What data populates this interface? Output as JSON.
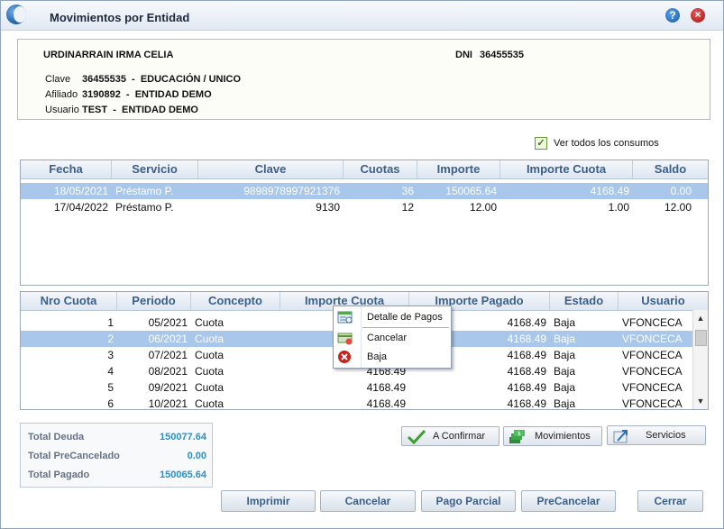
{
  "window": {
    "title": "Movimientos por Entidad"
  },
  "person": {
    "name": "URDINARRAIN IRMA CELIA",
    "dni_label": "DNI",
    "dni": "36455535",
    "clave_label": "Clave",
    "clave": "36455535  -  EDUCACIÓN / UNICO",
    "afiliado_label": "Afiliado",
    "afiliado": "3190892  -  ENTIDAD DEMO",
    "usuario_label": "Usuario",
    "usuario": "TEST  -  ENTIDAD DEMO"
  },
  "ver_todos": {
    "label": "Ver todos los consumos",
    "checked": true
  },
  "consumos": {
    "columns": [
      "Fecha",
      "Servicio",
      "Clave",
      "Cuotas",
      "Importe",
      "Importe Cuota",
      "Saldo"
    ],
    "rows": [
      [
        "18/05/2021",
        "Préstamo P.",
        "9898978997921376",
        "36",
        "150065.64",
        "4168.49",
        "0.00"
      ],
      [
        "17/04/2022",
        "Préstamo P.",
        "9130",
        "12",
        "12.00",
        "1.00",
        "12.00"
      ]
    ]
  },
  "cuotas": {
    "columns": [
      "Nro Cuota",
      "Periodo",
      "Concepto",
      "Importe Cuota",
      "Importe Pagado",
      "Estado",
      "Usuario"
    ],
    "rows": [
      [
        "1",
        "05/2021",
        "Cuota",
        "",
        "4168.49",
        "Baja",
        "VFONCECA"
      ],
      [
        "2",
        "06/2021",
        "Cuota",
        "",
        "4168.49",
        "Baja",
        "VFONCECA"
      ],
      [
        "3",
        "07/2021",
        "Cuota",
        "",
        "4168.49",
        "Baja",
        "VFONCECA"
      ],
      [
        "4",
        "08/2021",
        "Cuota",
        "4168.49",
        "4168.49",
        "Baja",
        "VFONCECA"
      ],
      [
        "5",
        "09/2021",
        "Cuota",
        "4168.49",
        "4168.49",
        "Baja",
        "VFONCECA"
      ],
      [
        "6",
        "10/2021",
        "Cuota",
        "4168.49",
        "4168.49",
        "Baja",
        "VFONCECA"
      ]
    ]
  },
  "context_menu": {
    "items": [
      "Detalle de Pagos",
      "Cancelar",
      "Baja"
    ]
  },
  "totals": {
    "deuda_label": "Total Deuda",
    "deuda": "150077.64",
    "precancelado_label": "Total PreCancelado",
    "precancelado": "0.00",
    "pagado_label": "Total Pagado",
    "pagado": "150065.64"
  },
  "action_buttons": {
    "confirmar": "A Confirmar",
    "movimientos": "Movimientos",
    "servicios": "Servicios"
  },
  "footer_buttons": {
    "imprimir": "Imprimir",
    "cancelar": "Cancelar",
    "pago_parcial": "Pago Parcial",
    "precancelar": "PreCancelar",
    "cerrar": "Cerrar"
  },
  "colors": {
    "header_text": "#3a5f8a",
    "selected_row": "#a9c7ea",
    "total_value": "#2d8fc9"
  },
  "icons": [
    "app-logo-icon",
    "help-icon",
    "close-icon",
    "checkbox-check-icon",
    "confirm-check-icon",
    "money-stack-icon",
    "services-arrow-icon",
    "payment-detail-icon",
    "cancel-card-icon",
    "delete-x-icon",
    "scroll-up-icon",
    "scroll-down-icon"
  ]
}
